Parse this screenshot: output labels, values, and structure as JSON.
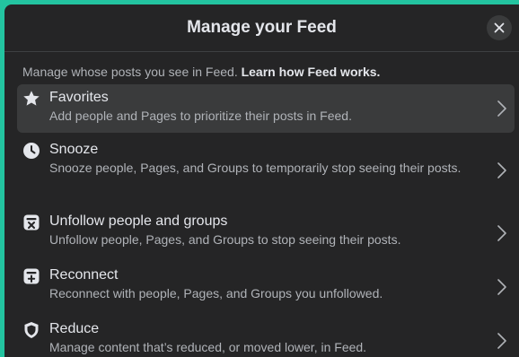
{
  "dialog": {
    "title": "Manage your Feed",
    "close_label": "✕",
    "intro_text": "Manage whose posts you see in Feed. ",
    "intro_link": "Learn how Feed works."
  },
  "items": [
    {
      "icon": "star-icon",
      "label": "Favorites",
      "description": "Add people and Pages to prioritize their posts in Feed."
    },
    {
      "icon": "clock-icon",
      "label": "Snooze",
      "description": "Snooze people, Pages, and Groups to temporarily stop seeing their posts."
    },
    {
      "icon": "unfollow-icon",
      "label": "Unfollow people and groups",
      "description": "Unfollow people, Pages, and Groups to stop seeing their posts."
    },
    {
      "icon": "reconnect-icon",
      "label": "Reconnect",
      "description": "Reconnect with people, Pages, and Groups you unfollowed."
    },
    {
      "icon": "shield-icon",
      "label": "Reduce",
      "description": "Manage content that’s reduced, or moved lower, in Feed."
    }
  ],
  "colors": {
    "background_accent": "#23c4a0",
    "dialog_bg": "#252526",
    "active_row": "#3a3b3c",
    "primary_text": "#e4e6eb",
    "secondary_text": "#b0b3b8"
  }
}
